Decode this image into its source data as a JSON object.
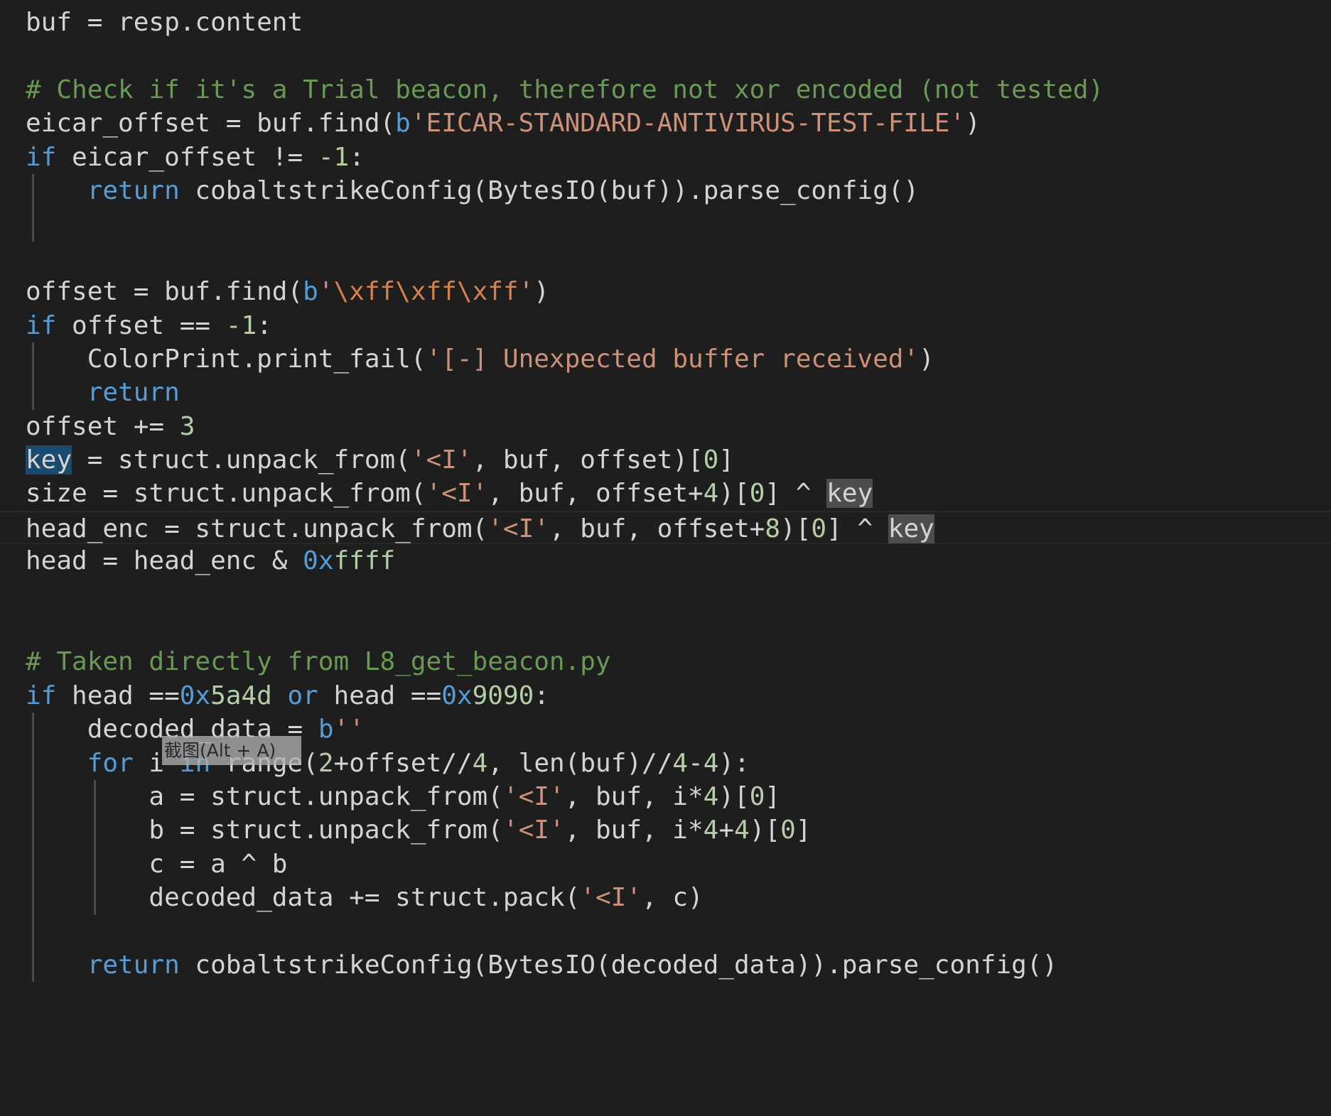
{
  "editor": {
    "language": "python",
    "theme": "dark-plus",
    "background_color": "#1e1e1e",
    "foreground_color": "#d4d4d4",
    "keyword_color": "#569cd6",
    "comment_color": "#6a9955",
    "string_color": "#ce9178",
    "number_color": "#b5cea8",
    "selection_color": "#1a4a6e",
    "occurrence_color": "#4d4d4d",
    "current_line_border_color": "#282828",
    "indent_guide_color": "#4a4a4a"
  },
  "overlay": {
    "capture_tooltip": "截图(Alt + A)"
  },
  "code": {
    "line_01": {
      "full": "buf = resp.content",
      "t1": "buf = resp.content"
    },
    "line_02": {
      "full": ""
    },
    "line_03": {
      "comment": "# Check if it's a Trial beacon, therefore not xor encoded (not tested)"
    },
    "line_04": {
      "pre": "eicar_offset = buf.find(",
      "bprefix": "b",
      "string": "'EICAR-STANDARD-ANTIVIRUS-TEST-FILE'",
      "post": ")"
    },
    "line_05": {
      "kw": "if",
      "rest": " eicar_offset != ",
      "num": "-1",
      "tail": ":"
    },
    "line_06": {
      "kw": "return",
      "rest": " cobaltstrikeConfig(BytesIO(buf)).parse_config()"
    },
    "line_07": {
      "full": ""
    },
    "line_08": {
      "full": ""
    },
    "line_09": {
      "pre": "offset = buf.find(",
      "bprefix": "b",
      "q1": "'",
      "esc": "\\xff\\xff\\xff",
      "q2": "'",
      "post": ")"
    },
    "line_10": {
      "kw": "if",
      "rest": " offset == ",
      "num": "-1",
      "tail": ":"
    },
    "line_11": {
      "pre": "ColorPrint.print_fail(",
      "string": "'[-] Unexpected buffer received'",
      "post": ")"
    },
    "line_12": {
      "kw": "return"
    },
    "line_13": {
      "pre": "offset += ",
      "num": "3"
    },
    "line_14": {
      "sel": "key",
      "mid": " = struct.unpack_from(",
      "string": "'<I'",
      "mid2": ", buf, offset)[",
      "num": "0",
      "tail": "]"
    },
    "line_15": {
      "pre": "size = struct.unpack_from(",
      "string": "'<I'",
      "mid": ", buf, offset+",
      "num4": "4",
      "mid2": ")[",
      "num0": "0",
      "mid3": "] ^ ",
      "occ": "key"
    },
    "line_16": {
      "pre": "head_enc = struct.unpack_from(",
      "string": "'<I'",
      "mid": ", buf, offset+",
      "num8": "8",
      "mid2": ")[",
      "num0": "0",
      "mid3": "] ^ ",
      "occ": "key",
      "is_current_line": true
    },
    "line_17": {
      "pre": "head = head_enc & ",
      "hexpfx": "0x",
      "hexval": "ffff"
    },
    "line_18": {
      "full": ""
    },
    "line_19": {
      "full": ""
    },
    "line_20": {
      "comment": "# Taken directly from L8_get_beacon.py"
    },
    "line_21": {
      "kw": "if",
      "rest": " head ==",
      "hexpfx1": "0x",
      "hexval1": "5a4d",
      "mid": " or",
      "rest2": " head ==",
      "hexpfx2": "0x",
      "hexval2": "9090",
      "tail": ":"
    },
    "line_22": {
      "pre": "decoded_data = ",
      "bprefix": "b",
      "string": "''"
    },
    "line_23": {
      "kw1": "for",
      "mid1": " i ",
      "kw2": "in",
      "mid2": " range(",
      "num2": "2",
      "mid3": "+offset//",
      "num4a": "4",
      "mid4": ", len(buf)//",
      "num4b": "4",
      "mid5": "-",
      "num4c": "4",
      "tail": "):"
    },
    "line_24": {
      "pre": "a = struct.unpack_from(",
      "string": "'<I'",
      "mid": ", buf, i*",
      "num4": "4",
      "mid2": ")[",
      "num0": "0",
      "tail": "]"
    },
    "line_25": {
      "pre": "b = struct.unpack_from(",
      "string": "'<I'",
      "mid": ", buf, i*",
      "num4a": "4",
      "mid2": "+",
      "num4b": "4",
      "mid3": ")[",
      "num0": "0",
      "tail": "]"
    },
    "line_26": {
      "full": "c = a ^ b"
    },
    "line_27": {
      "pre": "decoded_data += struct.pack(",
      "string": "'<I'",
      "post": ", c)"
    },
    "line_28": {
      "full": ""
    },
    "line_29": {
      "kw": "return",
      "rest": " cobaltstrikeConfig(BytesIO(decoded_data)).parse_config()"
    }
  }
}
